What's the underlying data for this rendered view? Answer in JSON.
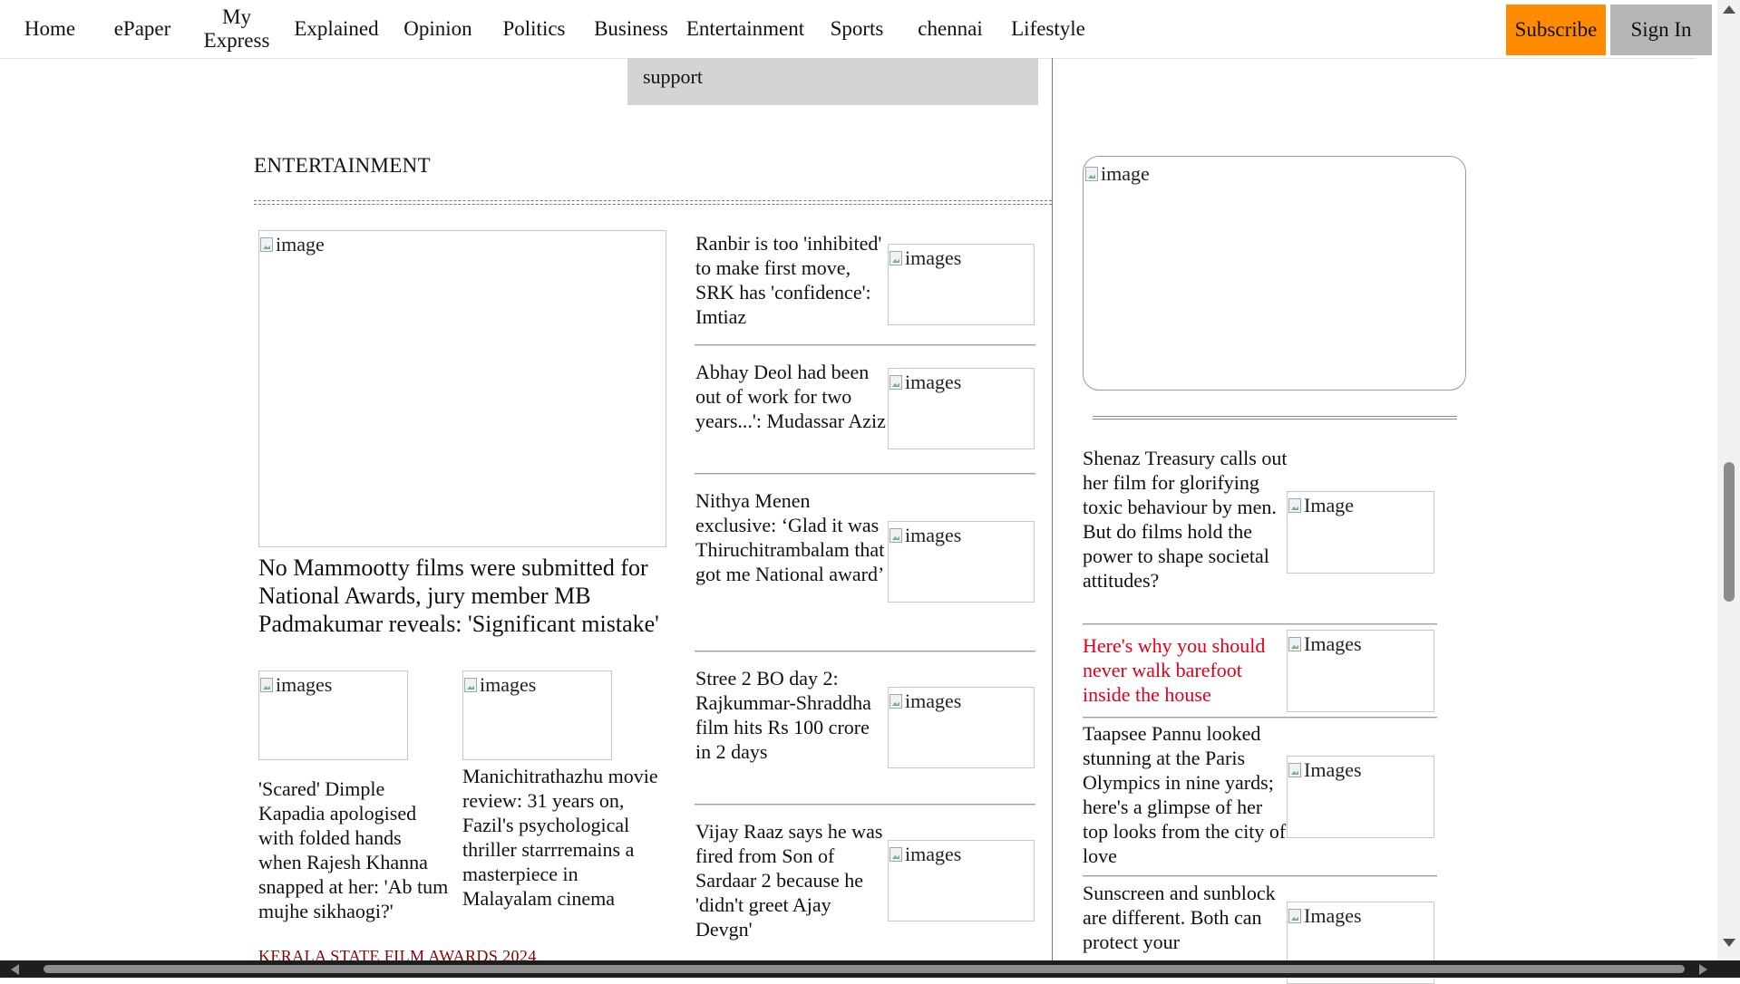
{
  "nav": {
    "items": [
      "Home",
      "ePaper",
      "My Express",
      "Explained",
      "Opinion",
      "Politics",
      "Business",
      "Entertainment",
      "Sports",
      "chennai",
      "Lifestyle"
    ],
    "subscribe": "Subscribe",
    "sign_in": "Sign In",
    "subscribe_color": "#ff8c00"
  },
  "support_box": {
    "text": "support"
  },
  "section": {
    "title": "ENTERTAINMENT"
  },
  "hero": {
    "image_alt": "image",
    "title": "No Mammootty films were submitted for National Awards, jury member MB Padmakumar reveals: 'Significant mistake'"
  },
  "sub_stories": [
    {
      "image_alt": "images",
      "title": "'Scared' Dimple Kapadia apologised with folded hands when Rajesh Khanna snapped at her: 'Ab tum mujhe sikhaogi?'"
    },
    {
      "image_alt": "images",
      "title": "Manichitrathazhu movie review: 31 years on, Fazil's psychological thriller starrremains a masterpiece in Malayalam cinema"
    }
  ],
  "kicker": "KERALA STATE FILM AWARDS 2024",
  "list_stories": [
    {
      "title": "Ranbir is too 'inhibited' to make first move, SRK has 'confidence': Imtiaz",
      "image_alt": "images"
    },
    {
      "title": "Abhay Deol had been out of work for two years...': Mudassar Aziz",
      "image_alt": "images"
    },
    {
      "title": "Nithya Menen exclusive: ‘Glad it was Thiruchitrambalam that got me National award’",
      "image_alt": "images"
    },
    {
      "title": "Stree 2 BO day 2: Rajkummar-Shraddha film hits Rs 100 crore in 2 days",
      "image_alt": "images"
    },
    {
      "title": "Vijay Raaz says he was fired from Son of Sardaar 2 because he 'didn't greet Ajay Devgn'",
      "image_alt": "images"
    }
  ],
  "sidebar": {
    "ad_alt": "image",
    "stories": [
      {
        "title": "Shenaz Treasury calls out her film for glorifying toxic behaviour by men. But do films hold the power to shape societal attitudes?",
        "image_alt": "Image",
        "highlight": false
      },
      {
        "title": "Here's why you should never walk barefoot inside the house",
        "image_alt": "Images",
        "highlight": true
      },
      {
        "title": "Taapsee Pannu looked stunning at the Paris Olympics in nine yards; here's a glimpse of her top looks from the city of love",
        "image_alt": "Images",
        "highlight": false
      },
      {
        "title": "Sunscreen and sunblock are different. Both can protect your",
        "image_alt": "Images",
        "highlight": false
      }
    ],
    "highlight_color": "#e0001b"
  }
}
